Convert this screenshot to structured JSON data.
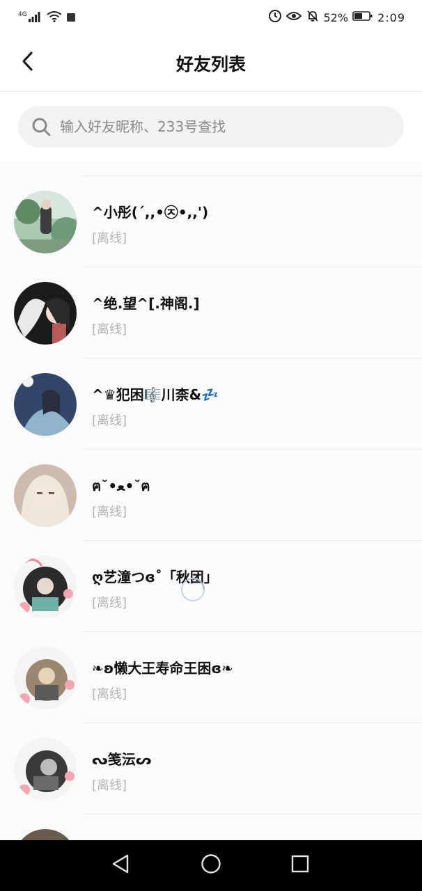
{
  "status_bar": {
    "network": "4G",
    "battery_percent": "52%",
    "time": "2:09"
  },
  "header": {
    "title": "好友列表"
  },
  "search": {
    "placeholder": "输入好友昵称、233号查找",
    "value": ""
  },
  "friends": [
    {
      "name": "^小彤(´,,•㉨•,,')",
      "status": "[离线]",
      "avatar_colors": [
        "#9fc3a8",
        "#e8e6e0",
        "#6b8f74"
      ]
    },
    {
      "name": "^绝.望^[.神阁.]",
      "status": "[离线]",
      "avatar_colors": [
        "#1b1b1b",
        "#eaeaea",
        "#c76a6a"
      ]
    },
    {
      "name": "^♛犯困🎼川柰&💤",
      "status": "[离线]",
      "avatar_colors": [
        "#3c4a6e",
        "#9fc0d6",
        "#d9c9b0"
      ]
    },
    {
      "name": "ฅ˘•ﻌ•˘ฅ",
      "status": "[离线]",
      "avatar_colors": [
        "#c9b8aa",
        "#f2eae3",
        "#7a6b62"
      ]
    },
    {
      "name": "ღ艺潼つɞ˚「秋团」",
      "status": "[离线]",
      "avatar_colors": [
        "#2b2b2b",
        "#7cb6b0",
        "#f4f4f4"
      ]
    },
    {
      "name": "❧ʚ懒大王寿命王困ɞ❧",
      "status": "[离线]",
      "avatar_colors": [
        "#8c7a68",
        "#e6d3b8",
        "#3e3e3e"
      ]
    },
    {
      "name": "ᔓ笺沄ᔕ",
      "status": "[离线]",
      "avatar_colors": [
        "#2e2e2e",
        "#c7c7c7",
        "#6e6e6e"
      ]
    }
  ],
  "icons": {
    "back": "back-arrow-icon",
    "search": "search-icon",
    "nav_back": "nav-back-icon",
    "nav_home": "nav-home-icon",
    "nav_recents": "nav-recents-icon"
  },
  "colors": {
    "status_text": "#b3b3b3",
    "search_bg": "#f2f2f4",
    "navbar_bg": "#000000"
  }
}
